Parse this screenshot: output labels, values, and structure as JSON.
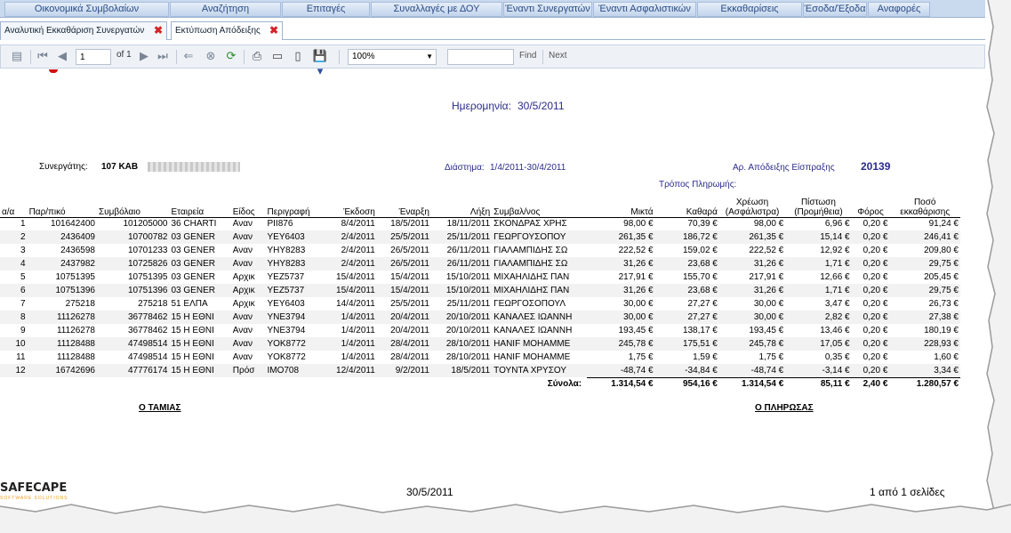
{
  "menu": [
    "Οικονομικά Συμβολαίων",
    "Αναζήτηση",
    "Επιταγές",
    "Συναλλαγές με ΔΟΥ",
    "Έναντι Συνεργατών",
    "Έναντι Ασφαλιστικών",
    "Εκκαθαρίσεις",
    "Έσοδα/Έξοδα",
    "Αναφορές"
  ],
  "tabs": [
    {
      "label": "Αναλυτική Εκκαθάριση Συνεργατών",
      "close": "✖"
    },
    {
      "label": "Εκτύπωση Απόδειξης",
      "close": "✖"
    }
  ],
  "toolbar": {
    "page_value": "1",
    "page_of": "of 1",
    "zoom": "100%",
    "find_value": "",
    "find_label": "Find",
    "next_label": "Next",
    "icons": [
      "tree-icon",
      "first-page-icon",
      "prev-page-icon",
      "next-page-icon",
      "last-page-icon",
      "back-icon",
      "stop-icon",
      "refresh-icon",
      "print-icon",
      "print-layout-icon",
      "page-setup-icon",
      "save-icon"
    ]
  },
  "report": {
    "date_label": "Ημερομηνία:",
    "date_value": "30/5/2011",
    "partner_label": "Συνεργάτης:",
    "partner_value": "107 ΚΑΒ",
    "period_label": "Διάστημα:",
    "period_value": "1/4/2011-30/4/2011",
    "receipt_label": "Αρ. Απόδειξης Είσπραξης",
    "receipt_value": "20139",
    "payment_header": "Τρόπος Πληρωμής:",
    "columns": [
      "α/α",
      "Παρ/πικό",
      "Συμβόλαιο",
      "Εταιρεία",
      "Είδος",
      "Περιγραφή",
      "Έκδοση",
      "Έναρξη",
      "Λήξη",
      "Συμβαλ/νος",
      "Μικτά",
      "Καθαρά",
      "Χρέωση (Ασφάλιστρα)",
      "Πίστωση (Προμήθεια)",
      "Φόρος",
      "Ποσό εκκαθάρισης"
    ],
    "rows": [
      [
        "1",
        "101642400",
        "101205000",
        "36 CHARTI",
        "Αναν",
        "PII876",
        "8/4/2011",
        "18/5/2011",
        "18/11/2011",
        "ΣΚΟΝΔΡΑΣ ΧΡΗΣ",
        "98,00 €",
        "70,39 €",
        "98,00 €",
        "6,96 €",
        "0,20 €",
        "91,24 €"
      ],
      [
        "2",
        "2436409",
        "10700782",
        "03 GENER",
        "Αναν",
        "YEY6403",
        "2/4/2011",
        "25/5/2011",
        "25/11/2011",
        "ΓΕΩΡΓΟΥΣΟΠΟΥ",
        "261,35 €",
        "186,72 €",
        "261,35 €",
        "15,14 €",
        "0,20 €",
        "246,41 €"
      ],
      [
        "3",
        "2436598",
        "10701233",
        "03 GENER",
        "Αναν",
        "YHY8283",
        "2/4/2011",
        "26/5/2011",
        "26/11/2011",
        "ΓΙΑΛΑΜΠΙΔΗΣ ΣΩ",
        "222,52 €",
        "159,02 €",
        "222,52 €",
        "12,92 €",
        "0,20 €",
        "209,80 €"
      ],
      [
        "4",
        "2437982",
        "10725826",
        "03 GENER",
        "Αναν",
        "YHY8283",
        "2/4/2011",
        "26/5/2011",
        "26/11/2011",
        "ΓΙΑΛΑΜΠΙΔΗΣ ΣΩ",
        "31,26 €",
        "23,68 €",
        "31,26 €",
        "1,71 €",
        "0,20 €",
        "29,75 €"
      ],
      [
        "5",
        "10751395",
        "10751395",
        "03 GENER",
        "Αρχικ",
        "YEZ5737",
        "15/4/2011",
        "15/4/2011",
        "15/10/2011",
        "ΜΙΧΑΗΛΙΔΗΣ ΠΑΝ",
        "217,91 €",
        "155,70 €",
        "217,91 €",
        "12,66 €",
        "0,20 €",
        "205,45 €"
      ],
      [
        "6",
        "10751396",
        "10751396",
        "03 GENER",
        "Αρχικ",
        "YEZ5737",
        "15/4/2011",
        "15/4/2011",
        "15/10/2011",
        "ΜΙΧΑΗΛΙΔΗΣ ΠΑΝ",
        "31,26 €",
        "23,68 €",
        "31,26 €",
        "1,71 €",
        "0,20 €",
        "29,75 €"
      ],
      [
        "7",
        "275218",
        "275218",
        "51 ΕΛΠΑ",
        "Αρχικ",
        "YEY6403",
        "14/4/2011",
        "25/5/2011",
        "25/11/2011",
        "ΓΕΩΡΓΟΣΟΠΟΥΛ",
        "30,00 €",
        "27,27 €",
        "30,00 €",
        "3,47 €",
        "0,20 €",
        "26,73 €"
      ],
      [
        "8",
        "11126278",
        "36778462",
        "15 Η ΕΘΝΙ",
        "Αναν",
        "YNE3794",
        "1/4/2011",
        "20/4/2011",
        "20/10/2011",
        "ΚΑΝΑΛΕΣ ΙΩΑΝΝΗ",
        "30,00 €",
        "27,27 €",
        "30,00 €",
        "2,82 €",
        "0,20 €",
        "27,38 €"
      ],
      [
        "9",
        "11126278",
        "36778462",
        "15 Η ΕΘΝΙ",
        "Αναν",
        "YNE3794",
        "1/4/2011",
        "20/4/2011",
        "20/10/2011",
        "ΚΑΝΑΛΕΣ ΙΩΑΝΝΗ",
        "193,45 €",
        "138,17 €",
        "193,45 €",
        "13,46 €",
        "0,20 €",
        "180,19 €"
      ],
      [
        "10",
        "11128488",
        "47498514",
        "15 Η ΕΘΝΙ",
        "Αναν",
        "YOK8772",
        "1/4/2011",
        "28/4/2011",
        "28/10/2011",
        "HANIF MOHAMME",
        "245,78 €",
        "175,51 €",
        "245,78 €",
        "17,05 €",
        "0,20 €",
        "228,93 €"
      ],
      [
        "11",
        "11128488",
        "47498514",
        "15 Η ΕΘΝΙ",
        "Αναν",
        "YOK8772",
        "1/4/2011",
        "28/4/2011",
        "28/10/2011",
        "HANIF MOHAMME",
        "1,75 €",
        "1,59 €",
        "1,75 €",
        "0,35 €",
        "0,20 €",
        "1,60 €"
      ],
      [
        "12",
        "16742696",
        "47776174",
        "15 Η ΕΘΝΙ",
        "Πρόσ",
        "IMO708",
        "12/4/2011",
        "9/2/2011",
        "18/5/2011",
        "ΤΟΥΝΤΑ ΧΡΥΣΟΥ",
        "-48,74 €",
        "-34,84 €",
        "-48,74 €",
        "-3,14 €",
        "0,20 €",
        "3,34 €"
      ]
    ],
    "totals_label": "Σύνολα:",
    "totals": [
      "1.314,54 €",
      "954,16 €",
      "1.314,54 €",
      "85,11 €",
      "2,40 €",
      "1.280,57 €"
    ],
    "cashier_label": "Ο ΤΑΜΙΑΣ",
    "payer_label": "Ο ΠΛΗΡΩΣΑΣ",
    "logo_text": "SAFECAPE",
    "logo_sub": "SOFTWARE SOLUTIONS",
    "footer_date": "30/5/2011",
    "footer_pages": "1 από 1 σελίδες"
  },
  "colors": {
    "menu_bg": "#c9d9ee",
    "menu_text": "#2a4d84",
    "accent_blue": "#2b2b8c",
    "tab_close": "#d3232a",
    "logo_orange": "#f29b1d"
  }
}
